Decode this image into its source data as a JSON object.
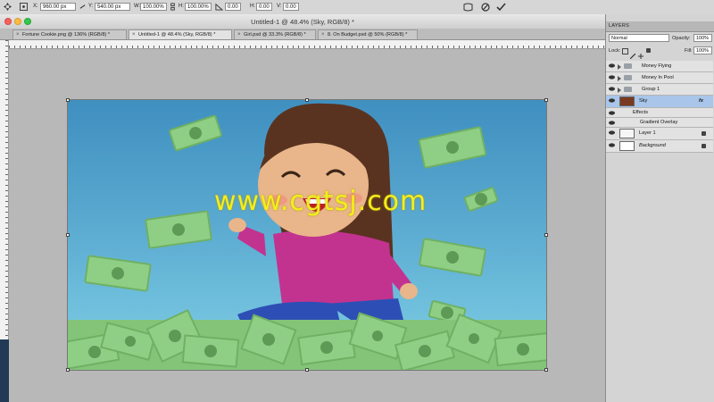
{
  "options_bar": {
    "x_label": "X:",
    "x_value": "960.00 px",
    "y_label": "Y:",
    "y_value": "540.00 px",
    "w_label": "W:",
    "w_value": "100.00%",
    "h_label": "H:",
    "h_value": "100.00%",
    "angle_value": "0.00",
    "hskew_label": "H:",
    "hskew_value": "0.00",
    "vskew_label": "V:",
    "vskew_value": "0.00"
  },
  "window": {
    "title": "Untitled-1 @ 48.4% (Sky, RGB/8) *"
  },
  "tabs": [
    {
      "label": "Fortune Cookie.png @ 136% (RGB/8) *",
      "active": false
    },
    {
      "label": "Untitled-1 @ 48.4% (Sky, RGB/8) *",
      "active": true
    },
    {
      "label": "Girl.psd @ 33.3% (RGB/8) *",
      "active": false
    },
    {
      "label": "8. On Budget.psd @ 50% (RGB/8) *",
      "active": false
    }
  ],
  "watermark": "www.cgtsj.com",
  "layers_panel": {
    "tab_label": "LAYERS",
    "blend_mode": "Normal",
    "opacity_label": "Opacity:",
    "opacity_value": "100%",
    "lock_label": "Lock:",
    "fill_label": "Fill:",
    "fill_value": "100%",
    "fx_badge": "fx",
    "layers": [
      {
        "name": "Money Flying",
        "kind": "group"
      },
      {
        "name": "Money In Pool",
        "kind": "group"
      },
      {
        "name": "Group 1",
        "kind": "group"
      },
      {
        "name": "Sky",
        "kind": "layer",
        "selected": true
      },
      {
        "name": "Effects",
        "kind": "effects"
      },
      {
        "name": "Gradient Overlay",
        "kind": "effect"
      },
      {
        "name": "Layer 1",
        "kind": "layer"
      },
      {
        "name": "Background",
        "kind": "background"
      }
    ]
  },
  "colors": {
    "sky_top": "#3f8fc0",
    "sky_bottom": "#7fd0e6",
    "bill_green": "#8fcf85",
    "hair": "#5a3320",
    "shirt": "#c2338f",
    "pants": "#2d4fb5",
    "skin": "#e9b58a",
    "watermark": "#f4ee1c",
    "selected_layer": "#a9c6ea"
  }
}
